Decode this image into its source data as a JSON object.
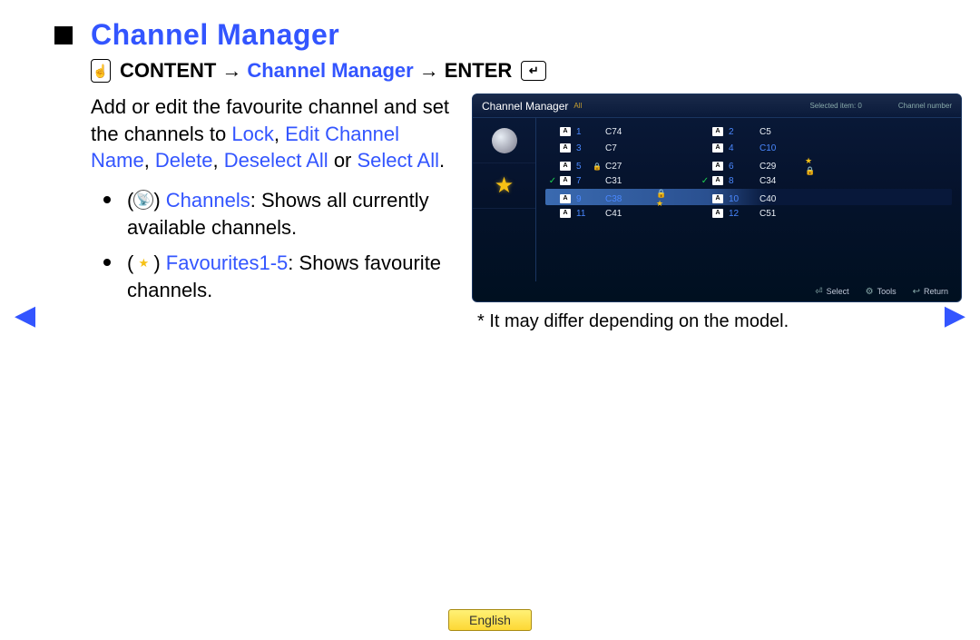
{
  "title": "Channel Manager",
  "breadcrumb": {
    "content": "CONTENT",
    "arrow": "→",
    "mid": "Channel Manager",
    "enter": "ENTER"
  },
  "description": {
    "pre": "Add or edit the favourite channel and set the channels to ",
    "lock": "Lock",
    "c1": ", ",
    "edit": "Edit Channel Name",
    "c2": ", ",
    "delete": "Delete",
    "c3": ", ",
    "deselect": "Deselect All",
    "c4": " or ",
    "select": "Select All",
    "end": "."
  },
  "bullets": {
    "channels": {
      "label": "Channels",
      "text": ": Shows all currently available channels."
    },
    "favourites": {
      "label": "Favourites1-5",
      "text": ": Shows favourite channels."
    }
  },
  "tv": {
    "title": "Channel Manager",
    "all": "All",
    "selected": "Selected item: 0",
    "chnum": "Channel number",
    "rows": [
      {
        "l_chk": "",
        "l_a": "A",
        "l_n": "1",
        "l_lock": "",
        "l_name": "C74",
        "l_star": "",
        "r_chk": "",
        "r_a": "A",
        "r_n": "2",
        "r_lock": "",
        "r_name": "C5",
        "r_star": ""
      },
      {
        "l_chk": "",
        "l_a": "A",
        "l_n": "3",
        "l_lock": "",
        "l_name": "C7",
        "l_star": "",
        "r_chk": "",
        "r_a": "A",
        "r_n": "4",
        "r_lock": "",
        "r_name": "C10",
        "r_name_blue": "1",
        "r_star": ""
      },
      {
        "l_chk": "",
        "l_a": "A",
        "l_n": "5",
        "l_lock": "🔒",
        "l_name": "C27",
        "l_star": "",
        "r_chk": "",
        "r_a": "A",
        "r_n": "6",
        "r_lock": "",
        "r_name": "C29",
        "r_star": "★🔒"
      },
      {
        "l_chk": "✓",
        "l_a": "A",
        "l_n": "7",
        "l_lock": "",
        "l_name": "C31",
        "l_star": "",
        "r_chk": "✓",
        "r_a": "A",
        "r_n": "8",
        "r_lock": "",
        "r_name": "C34",
        "r_star": ""
      },
      {
        "sel": "1",
        "l_chk": "",
        "l_a": "A",
        "l_n": "9",
        "l_lock": "",
        "l_name": "C38",
        "l_name_blue": "1",
        "l_star": "🔒★",
        "r_chk": "",
        "r_a": "A",
        "r_n": "10",
        "r_lock": "",
        "r_name": "C40",
        "r_star": ""
      },
      {
        "l_chk": "",
        "l_a": "A",
        "l_n": "11",
        "l_lock": "",
        "l_name": "C41",
        "l_star": "",
        "r_chk": "",
        "r_a": "A",
        "r_n": "12",
        "r_lock": "",
        "r_name": "C51",
        "r_star": ""
      }
    ],
    "footer": {
      "select": "Select",
      "tools": "Tools",
      "return": "Return"
    }
  },
  "note": "* It may differ depending on the model.",
  "language": "English"
}
